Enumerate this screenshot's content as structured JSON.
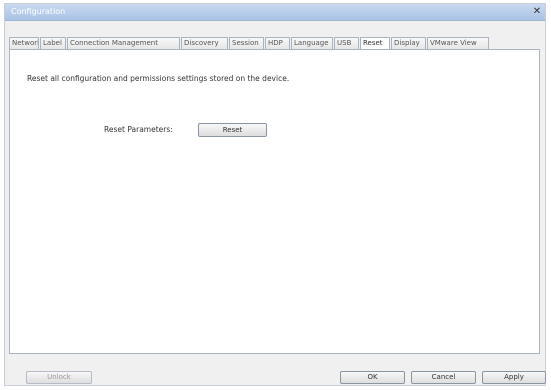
{
  "window": {
    "title": "Configuration",
    "close_symbol": "✕"
  },
  "tabs": [
    {
      "label": "Network",
      "width": 30
    },
    {
      "label": "Label",
      "width": 26
    },
    {
      "label": "Connection Management",
      "width": 113
    },
    {
      "label": "Discovery",
      "width": 47
    },
    {
      "label": "Session",
      "width": 35
    },
    {
      "label": "HDP",
      "width": 25
    },
    {
      "label": "Language",
      "width": 42
    },
    {
      "label": "USB",
      "width": 25
    },
    {
      "label": "Reset",
      "width": 30
    },
    {
      "label": "Display",
      "width": 35
    },
    {
      "label": "VMware View",
      "width": 62
    }
  ],
  "active_tab": "Reset",
  "panel": {
    "description": "Reset all configuration and permissions settings stored on the device.",
    "reset_label": "Reset Parameters:",
    "reset_button": "Reset"
  },
  "footer": {
    "unlock_button": "Unlock",
    "ok_button": "OK",
    "cancel_button": "Cancel",
    "apply_button": "Apply"
  }
}
